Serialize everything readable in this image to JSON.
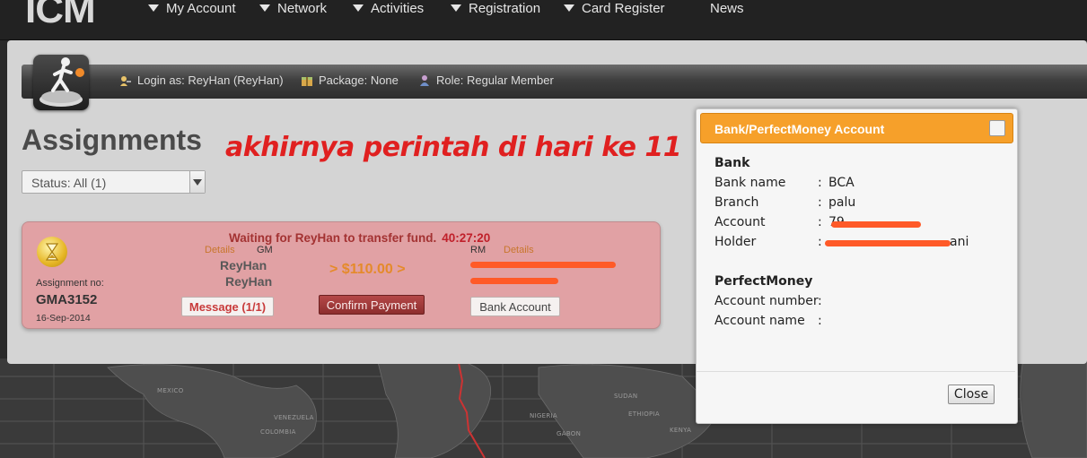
{
  "app": {
    "logo_text": "ICM"
  },
  "nav": {
    "items": [
      {
        "label": "My Account",
        "has_dropdown": true
      },
      {
        "label": "Network",
        "has_dropdown": true
      },
      {
        "label": "Activities",
        "has_dropdown": true
      },
      {
        "label": "Registration",
        "has_dropdown": true
      },
      {
        "label": "Card Register",
        "has_dropdown": true
      },
      {
        "label": "News",
        "has_dropdown": false
      }
    ]
  },
  "userbar": {
    "login": "Login as: ReyHan (ReyHan)",
    "package": "Package: None",
    "role": "Role: Regular Member"
  },
  "page": {
    "title": "Assignments",
    "annotation": "akhirnya perintah di hari ke 11",
    "status_filter": "Status: All (1)"
  },
  "assignment": {
    "waiting_text": "Waiting for ReyHan to transfer fund.",
    "timer": "40:27:20",
    "assignment_no_label": "Assignment no:",
    "assignment_no": "GMA3152",
    "date": "16-Sep-2014",
    "gm": {
      "details_label": "Details",
      "role_label": "GM",
      "name": "ReyHan",
      "username": "ReyHan"
    },
    "amount": "> $110.00 >",
    "rm": {
      "details_label": "Details",
      "role_label": "RM"
    },
    "buttons": {
      "message": "Message (1/1)",
      "confirm": "Confirm Payment",
      "bank": "Bank Account"
    }
  },
  "dialog": {
    "title": "Bank/PerfectMoney Account",
    "bank_section": "Bank",
    "rows": [
      {
        "label": "Bank name",
        "value": "BCA"
      },
      {
        "label": "Branch",
        "value": "palu"
      },
      {
        "label": "Account",
        "value": "79"
      },
      {
        "label": "Holder",
        "value": "ani"
      }
    ],
    "pm_section": "PerfectMoney",
    "pm_rows": [
      {
        "label": "Account number",
        "value": ""
      },
      {
        "label": "Account name",
        "value": ""
      }
    ],
    "close_label": "Close"
  },
  "colors": {
    "accent_orange": "#f6a02a",
    "annotation_red": "#e02020",
    "card_pink": "#e1a1a4",
    "redaction_orange": "#ff5a28"
  }
}
